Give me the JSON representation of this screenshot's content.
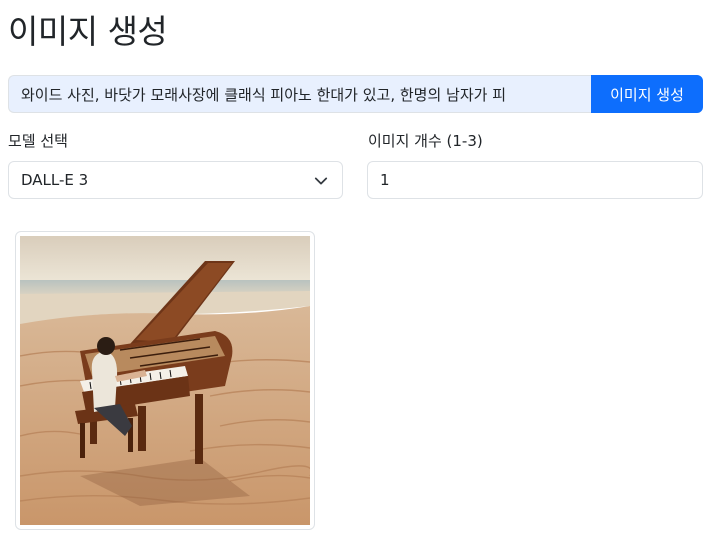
{
  "page": {
    "title": "이미지 생성"
  },
  "prompt": {
    "value": "와이드 사진, 바닷가 모래사장에 클래식 피아노 한대가 있고, 한명의 남자가 피",
    "button_label": "이미지 생성"
  },
  "model": {
    "label": "모델 선택",
    "selected": "DALL-E 3"
  },
  "count": {
    "label": "이미지 개수 (1-3)",
    "value": "1"
  },
  "gallery": {
    "images": [
      {
        "icon": "generated-image-piano-beach"
      }
    ]
  },
  "colors": {
    "primary": "#0d6efd",
    "input_autofill": "#e8f0fe",
    "border": "#dee2e6"
  }
}
